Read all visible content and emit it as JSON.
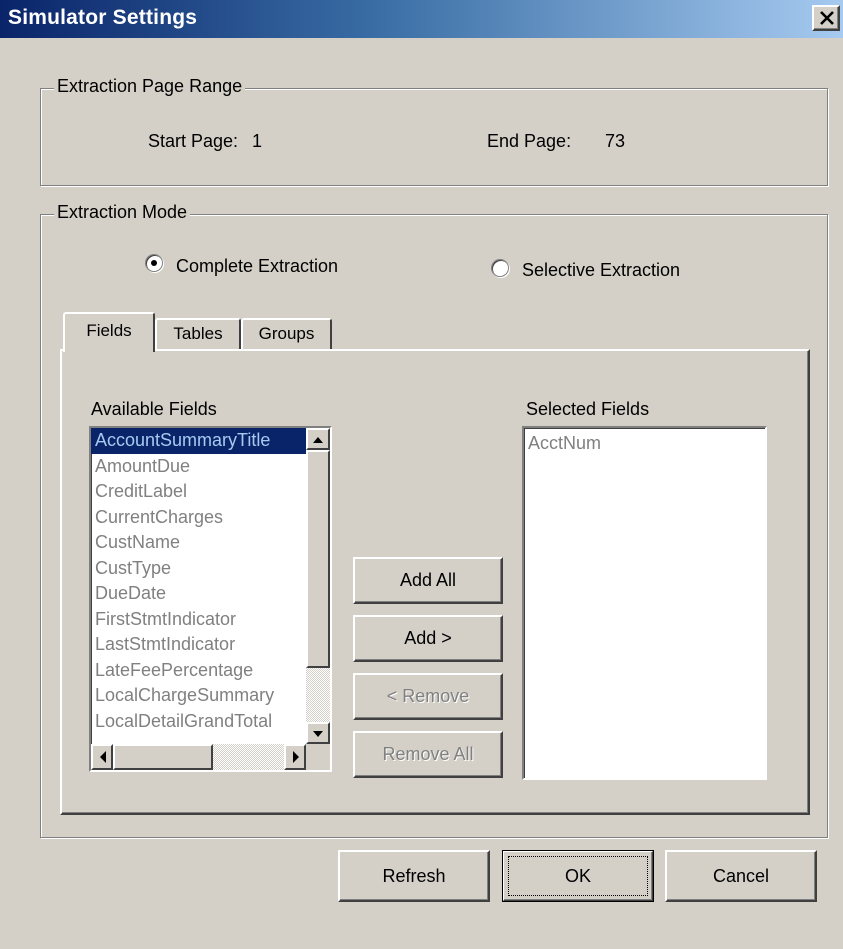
{
  "window": {
    "title": "Simulator Settings",
    "close_glyph": "✕"
  },
  "page_range": {
    "legend": "Extraction Page Range",
    "start_label": "Start Page:",
    "start_value": "1",
    "end_label": "End Page:",
    "end_value": "73"
  },
  "mode": {
    "legend": "Extraction Mode",
    "options": [
      {
        "label": "Complete Extraction",
        "checked": true
      },
      {
        "label": "Selective Extraction",
        "checked": false
      }
    ]
  },
  "tabs": [
    {
      "label": "Fields",
      "active": true
    },
    {
      "label": "Tables",
      "active": false
    },
    {
      "label": "Groups",
      "active": false
    }
  ],
  "available": {
    "label": "Available Fields",
    "items": [
      "AccountSummaryTitle",
      "AmountDue",
      "CreditLabel",
      "CurrentCharges",
      "CustName",
      "CustType",
      "DueDate",
      "FirstStmtIndicator",
      "LastStmtIndicator",
      "LateFeePercentage",
      "LocalChargeSummary",
      "LocalDetailGrandTotal"
    ],
    "selected_index": 0
  },
  "selected": {
    "label": "Selected Fields",
    "items": [
      "AcctNum"
    ]
  },
  "transfer_buttons": {
    "add_all": "Add All",
    "add": "Add >",
    "remove": "< Remove",
    "remove_all": "Remove All"
  },
  "footer": {
    "refresh": "Refresh",
    "ok": "OK",
    "cancel": "Cancel"
  },
  "colors": {
    "face": "#d4d0c8",
    "title_start": "#0a246a",
    "title_end": "#a6caf0",
    "selection": "#0a246a",
    "disabled_text": "#808080"
  }
}
